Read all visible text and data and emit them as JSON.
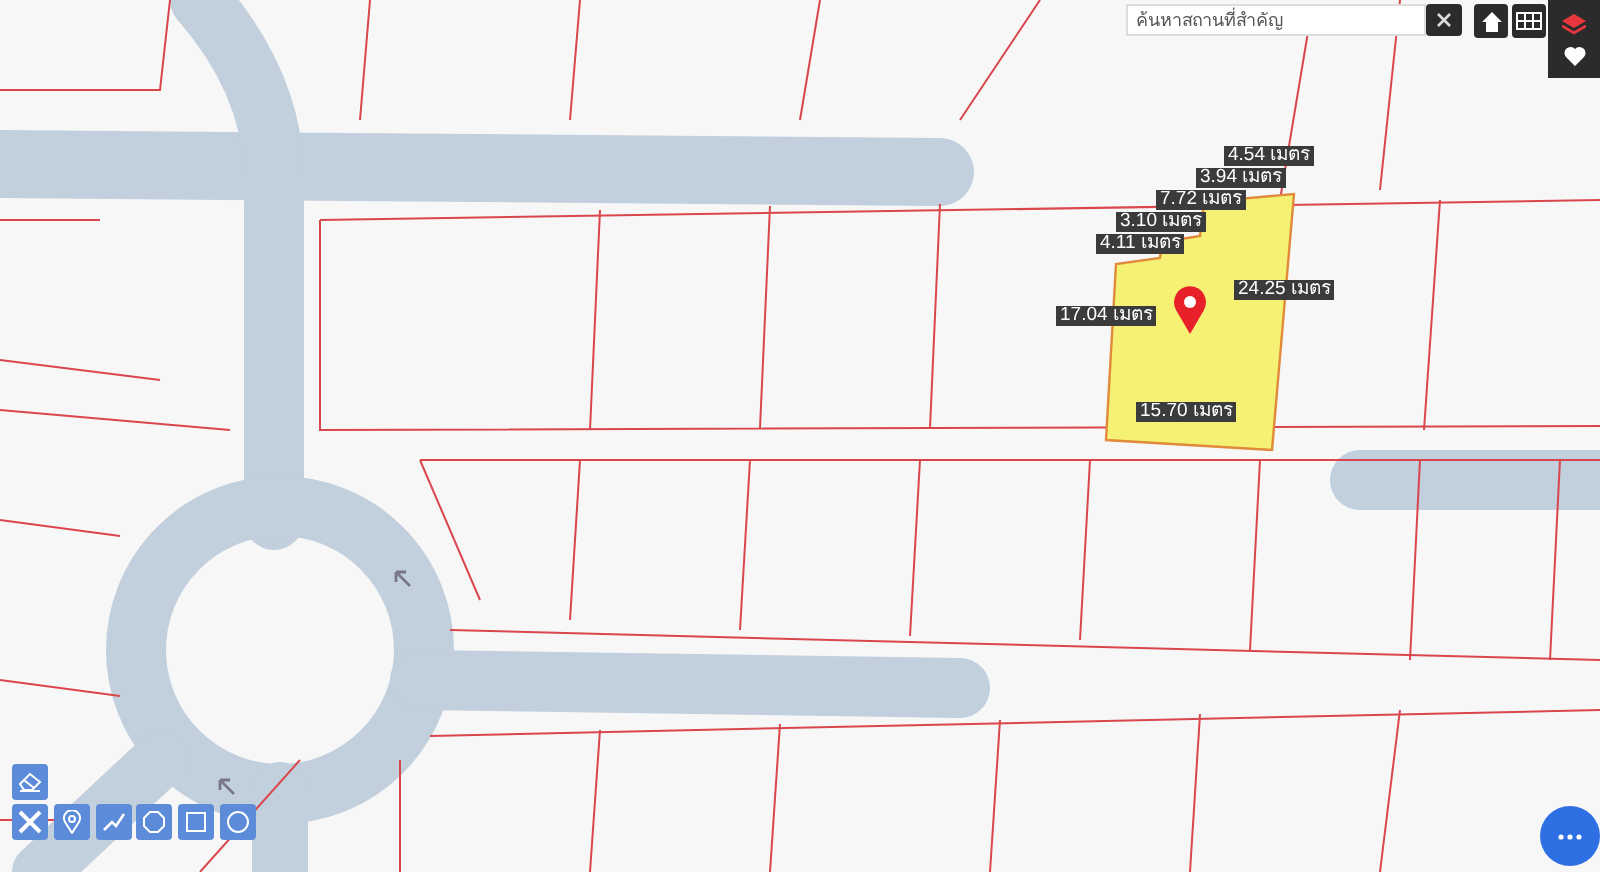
{
  "search": {
    "placeholder": "ค้นหาสถานที่สำคัญ"
  },
  "measurements": [
    {
      "label": "4.54 เมตร"
    },
    {
      "label": "3.94 เมตร"
    },
    {
      "label": "7.72 เมตร"
    },
    {
      "label": "3.10 เมตร"
    },
    {
      "label": "4.11 เมตร"
    },
    {
      "label": "17.04 เมตร"
    },
    {
      "label": "24.25 เมตร"
    },
    {
      "label": "15.70 เมตร"
    }
  ]
}
